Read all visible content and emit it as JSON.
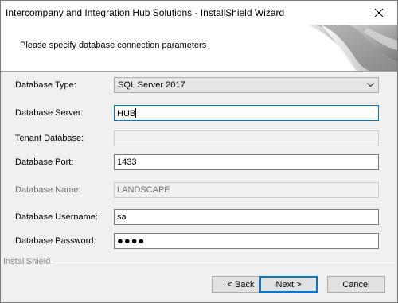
{
  "window": {
    "title": "Intercompany and Integration Hub Solutions - InstallShield Wizard",
    "close_icon": "close-icon"
  },
  "header": {
    "instruction": "Please specify database connection parameters"
  },
  "form": {
    "database_type": {
      "label": "Database Type:",
      "value": "SQL Server 2017",
      "enabled": true
    },
    "database_server": {
      "label": "Database Server:",
      "value": "HUB",
      "enabled": true,
      "focused": true
    },
    "tenant_database": {
      "label": "Tenant Database:",
      "value": "",
      "enabled": false
    },
    "database_port": {
      "label": "Database Port:",
      "value": "1433",
      "enabled": true
    },
    "database_name": {
      "label": "Database Name:",
      "value": "LANDSCAPE",
      "enabled": false
    },
    "database_username": {
      "label": "Database Username:",
      "value": "sa",
      "enabled": true
    },
    "database_password": {
      "label": "Database Password:",
      "value": "●●●●",
      "enabled": true
    }
  },
  "footer": {
    "brand": "InstallShield"
  },
  "buttons": {
    "back": "< Back",
    "next": "Next >",
    "cancel": "Cancel"
  },
  "colors": {
    "focus_border": "#0078d7",
    "window_bg": "#f0f0f0",
    "header_bg": "#ffffff"
  }
}
